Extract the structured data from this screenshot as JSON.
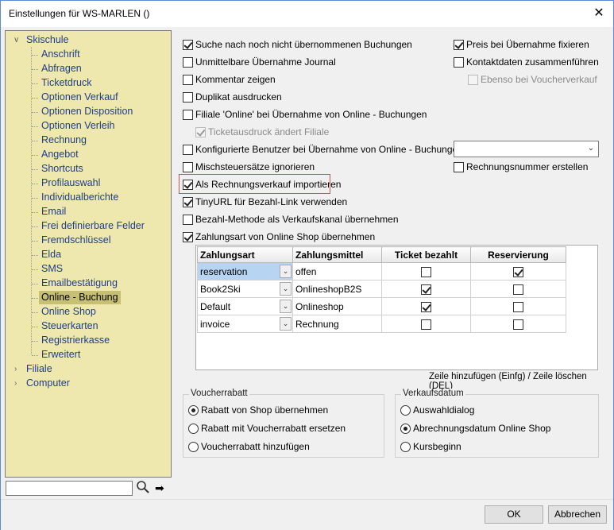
{
  "window": {
    "title": "Einstellungen für WS-MARLEN ()"
  },
  "tree": {
    "root": "Skischule",
    "children": [
      "Anschrift",
      "Abfragen",
      "Ticketdruck",
      "Optionen Verkauf",
      "Optionen Disposition",
      "Optionen Verleih",
      "Rechnung",
      "Angebot",
      "Shortcuts",
      "Profilauswahl",
      "Individualberichte",
      "Email",
      "Frei definierbare Felder",
      "Fremdschlüssel",
      "Elda",
      "SMS",
      "Emailbestätigung",
      "Online - Buchung",
      "Online Shop",
      "Steuerkarten",
      "Registrierkasse",
      "Erweitert"
    ],
    "selected": "Online - Buchung",
    "others": [
      "Filiale",
      "Computer"
    ]
  },
  "search": {
    "value": ""
  },
  "options_left": [
    {
      "label": "Suche nach noch nicht übernommenen Buchungen",
      "checked": true
    },
    {
      "label": "Unmittelbare Übernahme Journal",
      "checked": false
    },
    {
      "label": "Kommentar zeigen",
      "checked": false
    },
    {
      "label": "Duplikat ausdrucken",
      "checked": false
    },
    {
      "label": "Filiale 'Online' bei Übernahme von Online - Buchungen",
      "checked": false
    },
    {
      "label": "Ticketausdruck ändert Filiale",
      "checked": true,
      "disabled": true
    },
    {
      "label": "Konfigurierte Benutzer bei Übernahme von Online - Buchungen",
      "checked": false
    },
    {
      "label": "Mischsteuersätze ignorieren",
      "checked": false
    },
    {
      "label": "Als Rechnungsverkauf importieren",
      "checked": true
    },
    {
      "label": "TinyURL für Bezahl-Link verwenden",
      "checked": true
    },
    {
      "label": "Bezahl-Methode als Verkaufskanal übernehmen",
      "checked": false
    },
    {
      "label": "Zahlungsart von Online Shop übernehmen",
      "checked": true
    }
  ],
  "options_right": [
    {
      "label": "Preis bei Übernahme fixieren",
      "checked": true
    },
    {
      "label": "Kontaktdaten zusammenführen",
      "checked": false
    },
    {
      "label": "Ebenso bei Voucherverkauf",
      "checked": false,
      "disabled": true
    },
    {
      "label": "Rechnungsnummer erstellen",
      "checked": false
    }
  ],
  "user_combo": {
    "value": ""
  },
  "grid": {
    "headers": [
      "Zahlungsart",
      "Zahlungsmittel",
      "Ticket bezahlt",
      "Reservierung"
    ],
    "rows": [
      {
        "zahlungsart": "reservation",
        "zahlungsmittel": "offen",
        "ticket_bezahlt": false,
        "reservierung": true
      },
      {
        "zahlungsart": "Book2Ski",
        "zahlungsmittel": "OnlineshopB2S",
        "ticket_bezahlt": true,
        "reservierung": false
      },
      {
        "zahlungsart": "Default",
        "zahlungsmittel": "Onlineshop",
        "ticket_bezahlt": true,
        "reservierung": false
      },
      {
        "zahlungsart": "invoice",
        "zahlungsmittel": "Rechnung",
        "ticket_bezahlt": false,
        "reservierung": false
      }
    ],
    "hint": "Zeile hinzufügen (Einfg) / Zeile löschen (DEL)"
  },
  "voucherrabatt": {
    "title": "Voucherrabatt",
    "options": [
      "Rabatt von Shop übernehmen",
      "Rabatt mit Voucherrabatt ersetzen",
      "Voucherrabatt hinzufügen"
    ],
    "selected": 0
  },
  "verkaufsdatum": {
    "title": "Verkaufsdatum",
    "options": [
      "Auswahldialog",
      "Abrechnungsdatum Online Shop",
      "Kursbeginn"
    ],
    "selected": 1
  },
  "buttons": {
    "ok": "OK",
    "cancel": "Abbrechen"
  },
  "icons": {
    "close": "close-icon",
    "search": "search-icon",
    "go": "arrow-right-icon"
  }
}
